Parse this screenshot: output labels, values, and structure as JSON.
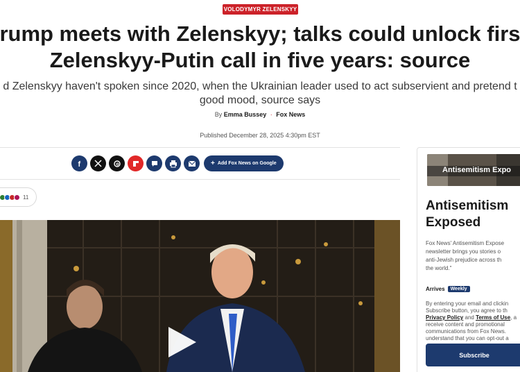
{
  "article": {
    "badge": "VOLODYMYR ZELENSKYY",
    "headline_line1": "rump meets with Zelenskyy; talks could unlock firs",
    "headline_line2": "Zelenskyy-Putin call in five years: source",
    "subhead_line1": "d Zelenskyy haven't spoken since 2020, when the Ukrainian leader used to act subservient and pretend t",
    "subhead_line2": "good mood, source says",
    "byline_prefix": "By",
    "author": "Emma Bussey",
    "outlet": "Fox News",
    "published": "Published December 28, 2025 4:30pm EST"
  },
  "share": {
    "icons": [
      "facebook-icon",
      "x-icon",
      "threads-icon",
      "flipboard-icon",
      "comment-icon",
      "print-icon",
      "email-icon"
    ],
    "google_label": "Add Fox News on Google"
  },
  "reactions": {
    "count": "11",
    "colors": [
      "#2e7d32",
      "#1565c0",
      "#c62828",
      "#ad1457"
    ]
  },
  "video": {
    "play_icon": "play-icon"
  },
  "sidebar": {
    "image_text": "Antisemitism Expo",
    "title_line1": "Antisemitism",
    "title_line2": "Exposed",
    "desc_line1": "Fox News' Antisemitism Expose",
    "desc_line2": "newsletter brings you stories o",
    "desc_line3": "anti-Jewish prejudice across th",
    "desc_line4": "the world.\"",
    "arrives_label": "Arrives",
    "frequency": "Weekly",
    "legal_line1": "By entering your email and clickin",
    "legal_line2": "Subscribe button, you agree to th",
    "legal_line3a": "Privacy Policy",
    "legal_line3b": " and ",
    "legal_line3c": "Terms of Use",
    "legal_line3d": ", a",
    "legal_line4": "receive content and promotional",
    "legal_line5": "communications from Fox News.",
    "legal_line6": "understand that you can opt-out a",
    "subscribe_label": "Subscribe"
  },
  "colors": {
    "brand_navy": "#1d3a6e",
    "accent_red": "#cc2229"
  }
}
